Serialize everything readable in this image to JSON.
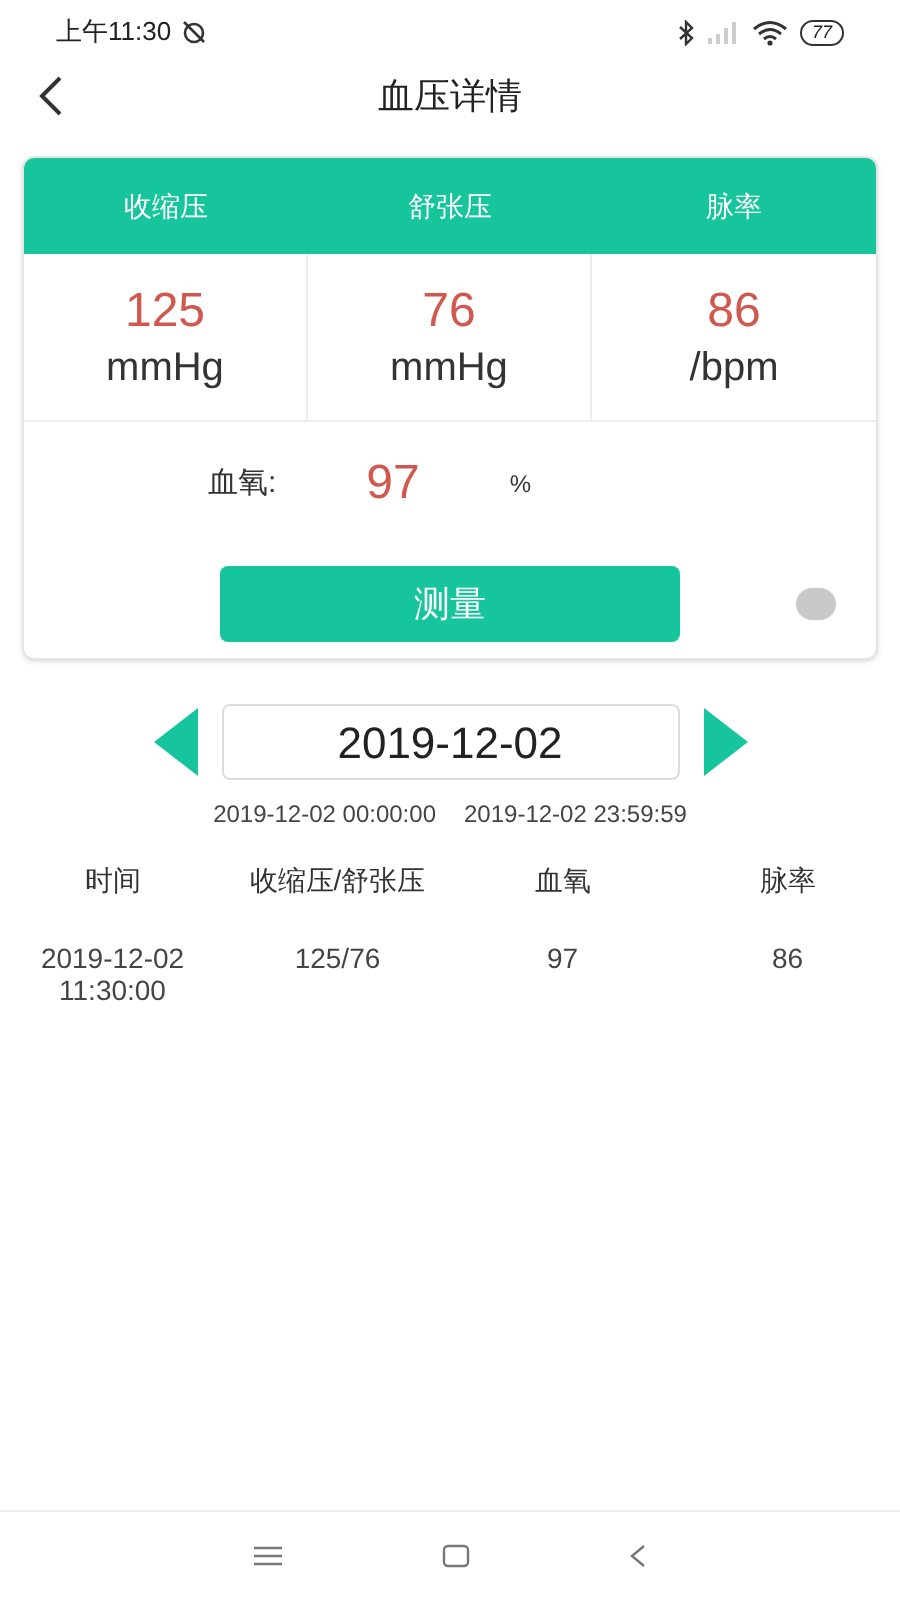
{
  "status_bar": {
    "time": "上午11:30",
    "battery": "77"
  },
  "header": {
    "title": "血压详情"
  },
  "metrics": [
    {
      "label": "收缩压",
      "value": "125",
      "unit": "mmHg"
    },
    {
      "label": "舒张压",
      "value": "76",
      "unit": "mmHg"
    },
    {
      "label": "脉率",
      "value": "86",
      "unit": "/bpm"
    }
  ],
  "oxygen": {
    "label": "血氧:",
    "value": "97",
    "unit": "%"
  },
  "measure_button": "测量",
  "device": {
    "connected": false
  },
  "date_nav": {
    "date": "2019-12-02",
    "start": "2019-12-02 00:00:00",
    "end": "2019-12-02 23:59:59"
  },
  "table": {
    "columns": [
      "时间",
      "收缩压/舒张压",
      "血氧",
      "脉率"
    ],
    "rows": [
      [
        "2019-12-02\n11:30:00",
        "125/76",
        "97",
        "86"
      ]
    ]
  }
}
